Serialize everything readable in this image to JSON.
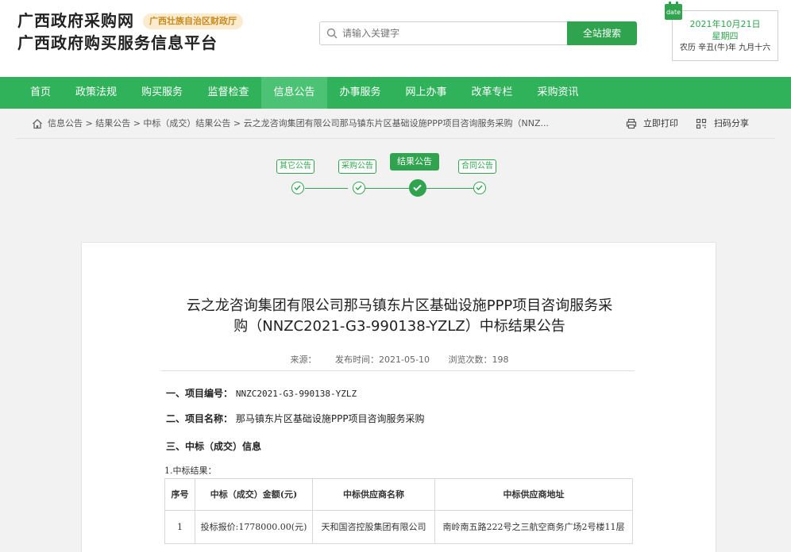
{
  "header": {
    "title_line1": "广西政府采购网",
    "title_line2": "广西政府购买服务信息平台",
    "dept_badge": "广西壮族自治区财政厅",
    "search_placeholder": "请输入关键字",
    "search_button": "全站搜索",
    "date_tag": "date",
    "date_line1": "2021年10月21日",
    "date_line2": "星期四",
    "date_line3": "农历 辛丑(牛)年 九月十六"
  },
  "nav": {
    "items": [
      "首页",
      "政策法规",
      "购买服务",
      "监督检查",
      "信息公告",
      "办事服务",
      "网上办事",
      "改革专栏",
      "采购资讯"
    ],
    "active_index": 4
  },
  "breadcrumb": {
    "text": "信息公告 > 结果公告 > 中标（成交）结果公告 > 云之龙咨询集团有限公司那马镇东片区基础设施PPP项目咨询服务采购（NNZ...",
    "print_label": "立即打印",
    "share_label": "扫码分享"
  },
  "steps": {
    "items": [
      "其它公告",
      "采购公告",
      "结果公告",
      "合同公告"
    ],
    "active_index": 2
  },
  "document": {
    "title_line1": "云之龙咨询集团有限公司那马镇东片区基础设施PPP项目咨询服务采",
    "title_line2": "购（NNZC2021-G3-990138-YZLZ）中标结果公告",
    "source_label": "来源：",
    "publish_time": "发布时间：2021-05-10",
    "views": "浏览次数：198",
    "item1_label": "一、项目编号：",
    "item1_value": "NNZC2021-G3-990138-YZLZ",
    "item2_label": "二、项目名称：",
    "item2_value": "那马镇东片区基础设施PPP项目咨询服务采购",
    "item3_label": "三、中标（成交）信息",
    "sub_label": "1.中标结果：",
    "table": {
      "headers": [
        "序号",
        "中标（成交）金额(元)",
        "中标供应商名称",
        "中标供应商地址"
      ],
      "rows": [
        [
          "1",
          "投标报价:1778000.00(元)",
          "天和国咨控股集团有限公司",
          "南岭南五路222号之三航空商务广场2号楼11层"
        ]
      ]
    }
  },
  "colors": {
    "brand_green": "#2fb25a",
    "accent_green": "#2fa34e",
    "badge_bg": "#fbeccf",
    "badge_text": "#c88a1e"
  }
}
